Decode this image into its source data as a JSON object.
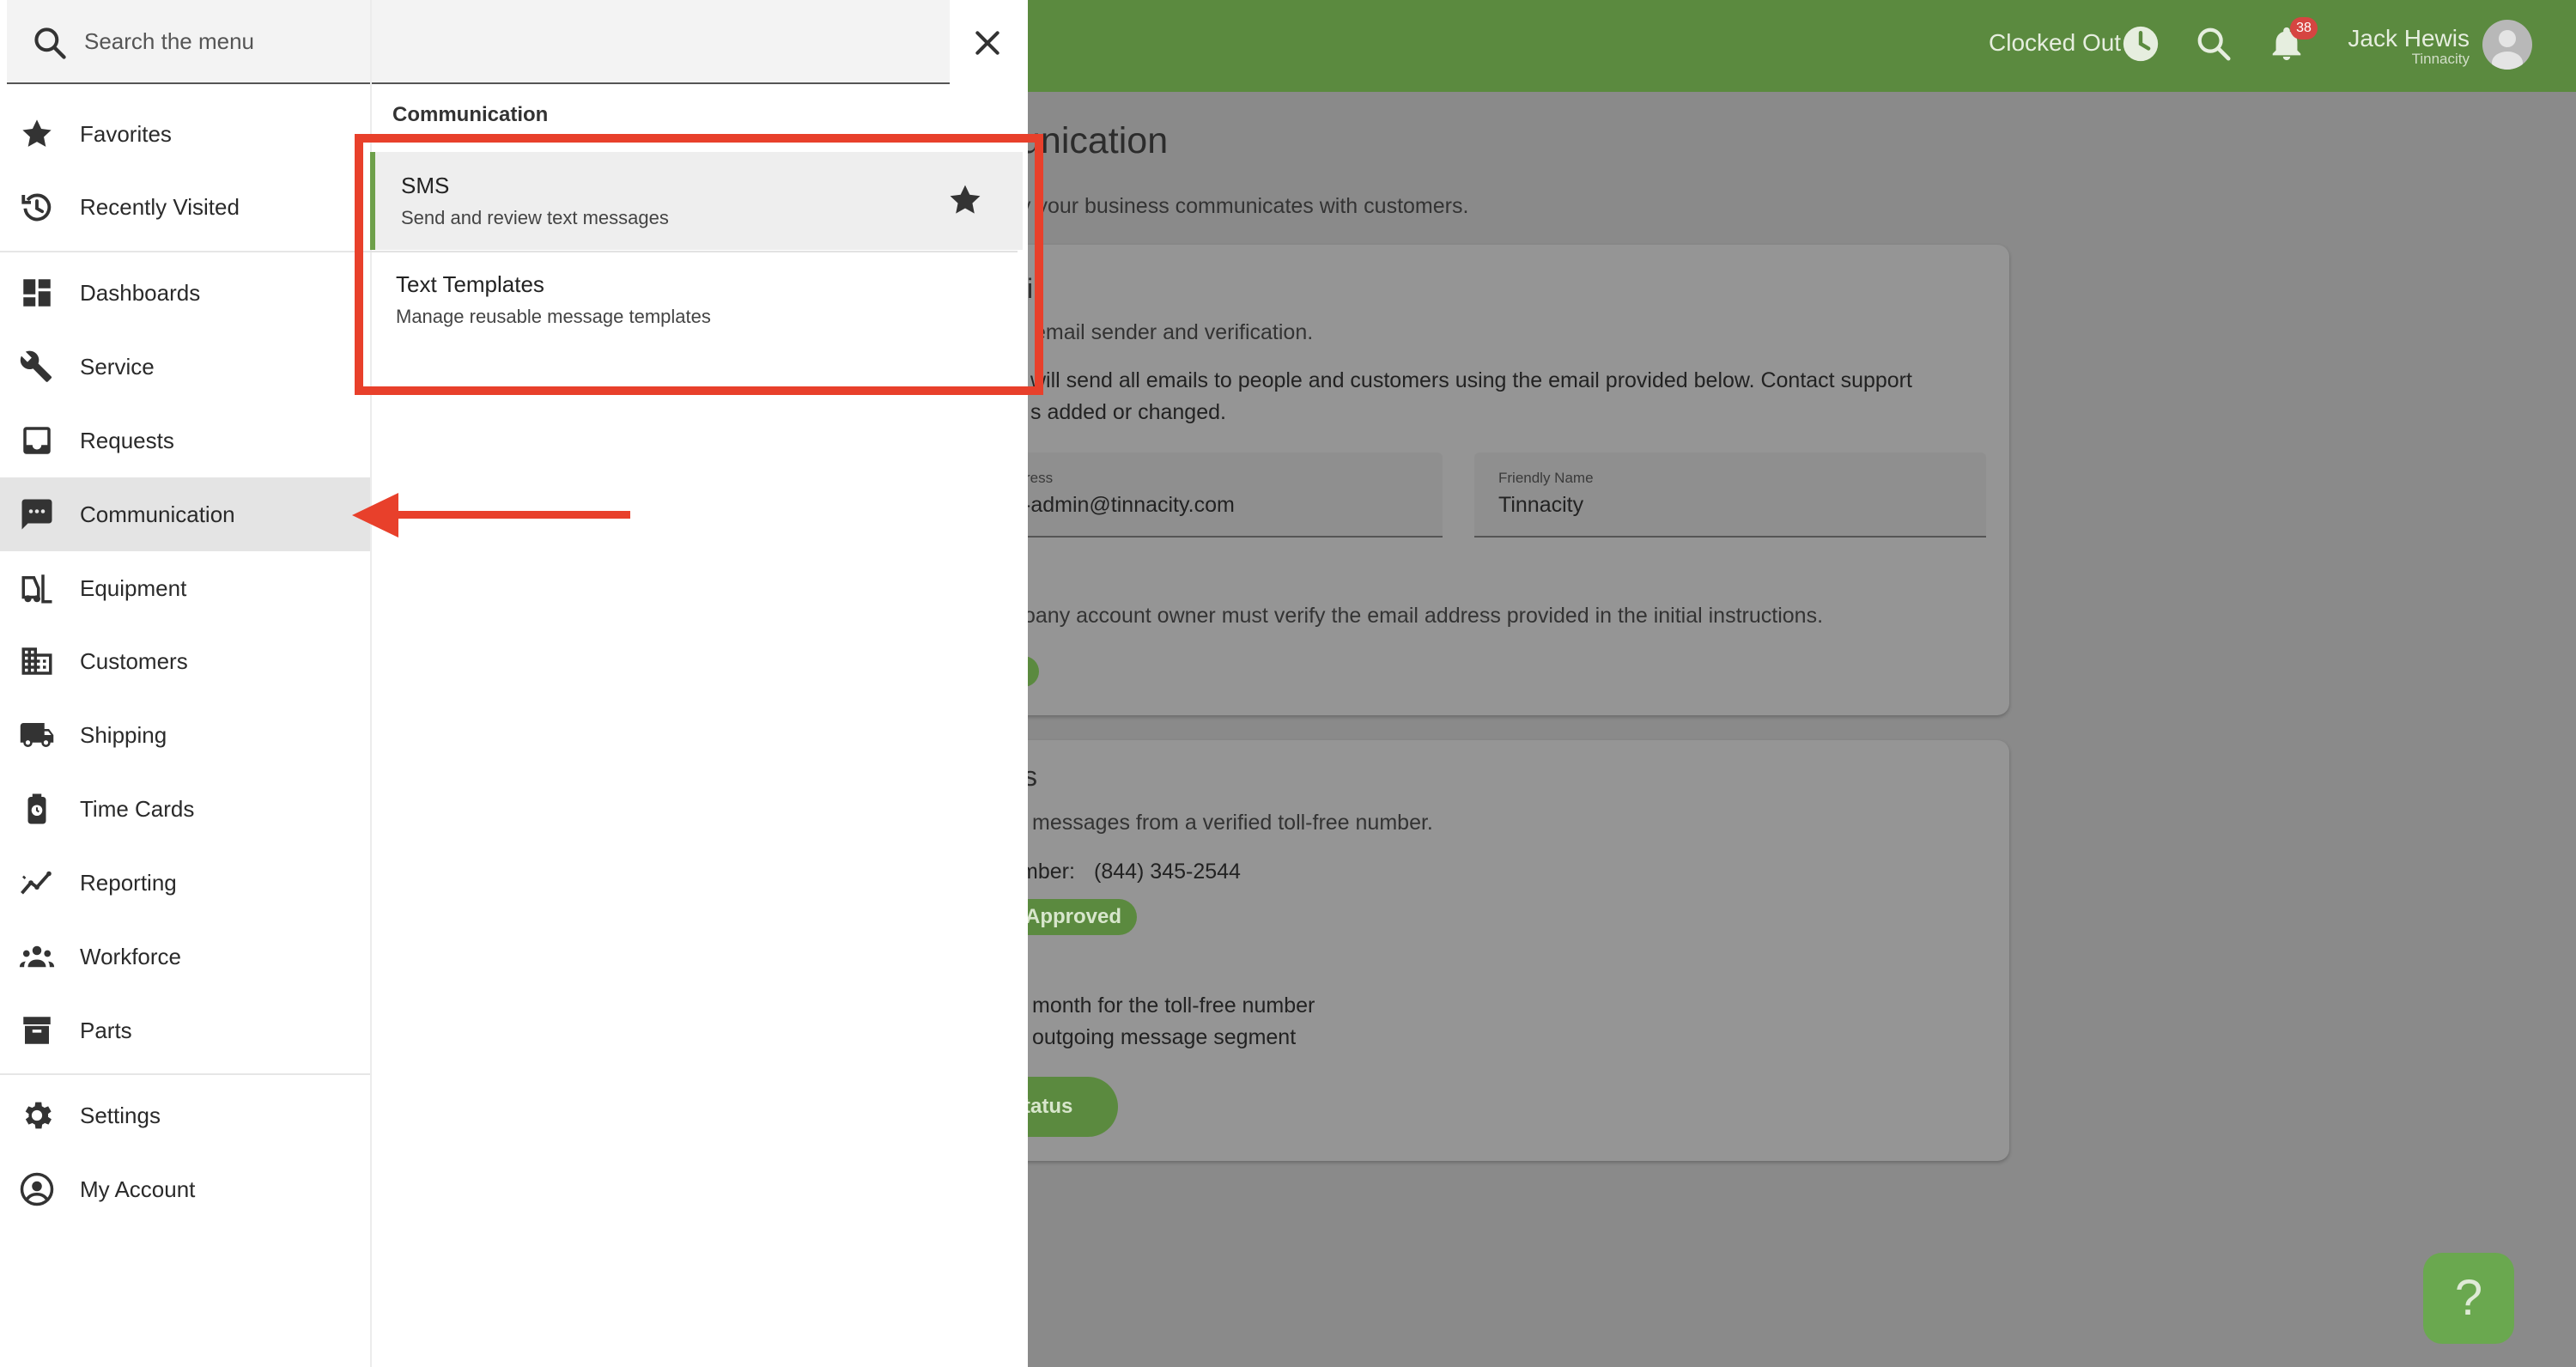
{
  "topbar": {
    "clock_status": "Clocked Out",
    "notification_count": "38",
    "user_name": "Jack Hewis",
    "user_org": "Tinnacity"
  },
  "background": {
    "page_title": "unication",
    "page_subtitle": "y your business communicates with customers.",
    "email_card": {
      "title": "il",
      "subtitle": "email sender and verification.",
      "body_line1": "will send all emails to people and customers using the email provided below. Contact support",
      "body_line2": "s added or changed.",
      "email_label": "ress",
      "email_value": "-admin@tinnacity.com",
      "friendly_label": "Friendly Name",
      "friendly_value": "Tinnacity",
      "verify_note": "oany account owner must verify the email address provided in the initial instructions."
    },
    "sms_card": {
      "title": "s",
      "subtitle": "messages from a verified toll-free number.",
      "number_label": "mber:",
      "number_value": "(844) 345-2544",
      "status": "Approved",
      "cost_line1": "month for the toll-free number",
      "cost_line2": "outgoing message segment",
      "button_label": "tatus"
    },
    "help_label": "?"
  },
  "menu": {
    "search_placeholder": "Search the menu",
    "section_title": "Communication",
    "nav_items": [
      {
        "label": "Favorites",
        "icon": "star-icon"
      },
      {
        "label": "Recently Visited",
        "icon": "history-icon"
      },
      {
        "label": "Dashboards",
        "icon": "dashboard-icon"
      },
      {
        "label": "Service",
        "icon": "wrench-icon"
      },
      {
        "label": "Requests",
        "icon": "inbox-icon"
      },
      {
        "label": "Communication",
        "icon": "chat-icon",
        "active": true
      },
      {
        "label": "Equipment",
        "icon": "forklift-icon"
      },
      {
        "label": "Customers",
        "icon": "building-icon"
      },
      {
        "label": "Shipping",
        "icon": "truck-icon"
      },
      {
        "label": "Time Cards",
        "icon": "timecard-icon"
      },
      {
        "label": "Reporting",
        "icon": "trend-icon"
      },
      {
        "label": "Workforce",
        "icon": "group-icon"
      },
      {
        "label": "Parts",
        "icon": "archive-icon"
      },
      {
        "label": "Settings",
        "icon": "gear-icon"
      },
      {
        "label": "My Account",
        "icon": "account-icon"
      }
    ],
    "sub_items": [
      {
        "title": "SMS",
        "description": "Send and review text messages"
      },
      {
        "title": "Text Templates",
        "description": "Manage reusable message templates"
      }
    ]
  },
  "colors": {
    "topbar": "#5b8a3f",
    "accent": "#6ea04a",
    "annotation": "#e8402b"
  }
}
